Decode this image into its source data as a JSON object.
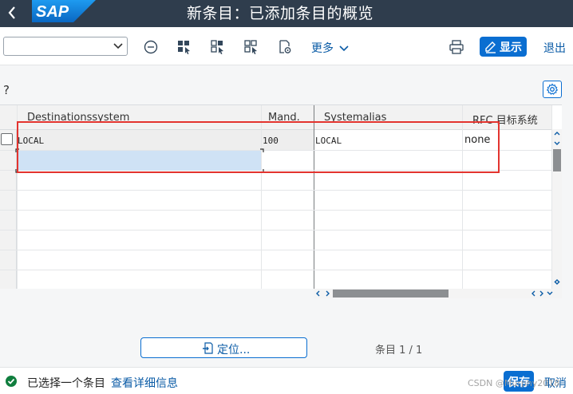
{
  "header": {
    "title": "新条目：已添加条目的概览",
    "logo_text": "SAP"
  },
  "toolbar": {
    "combo_value": "",
    "more_label": "更多",
    "display_label": "显示",
    "exit_label": "退出"
  },
  "content": {
    "prompt_text": "?"
  },
  "table": {
    "columns": [
      "Destinationssystem",
      "Mand.",
      "Systemalias",
      "RFC 目标系统"
    ],
    "rows": [
      {
        "destination": "LOCAL",
        "client": "100",
        "alias": "LOCAL",
        "rfc": "none"
      }
    ]
  },
  "footer": {
    "locate_label": "定位...",
    "entry_count": "条目 1 / 1"
  },
  "status": {
    "message": "已选择一个条目",
    "details_link": "查看详细信息",
    "save_label": "保存",
    "cancel_label": "取消",
    "watermark": "CSDN @Murphy2018"
  },
  "colors": {
    "title_bg": "#2f3d4d",
    "accent": "#0a6ed1",
    "highlight": "#e3342f",
    "selected_cell": "#cfe2f5"
  }
}
